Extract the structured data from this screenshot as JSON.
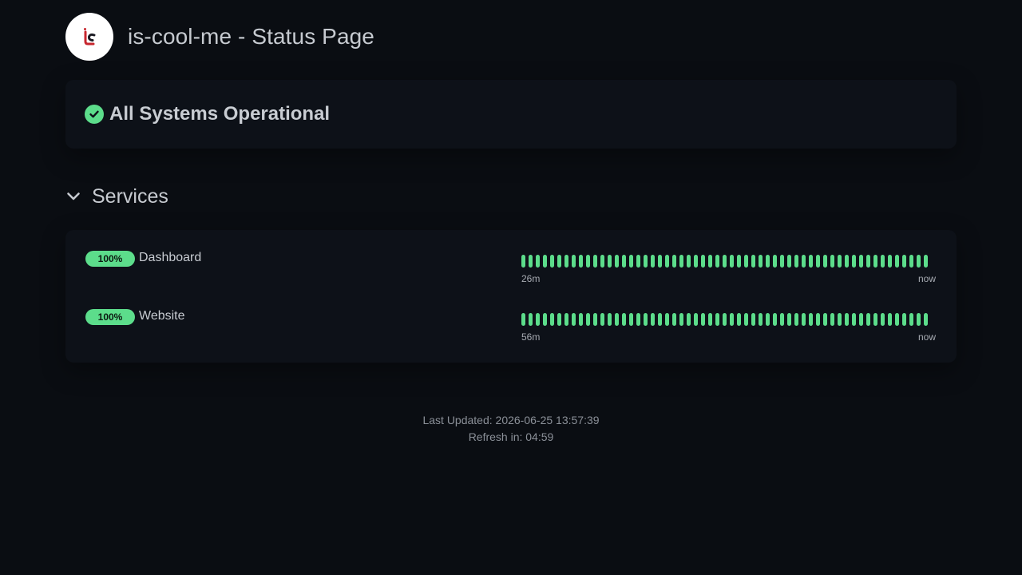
{
  "header": {
    "title": "is-cool-me - Status Page",
    "logo_icon": "brand-logo-icon"
  },
  "overall": {
    "text": "All Systems Operational",
    "icon": "check-circle-icon",
    "color": "#5cdd8b"
  },
  "group": {
    "title": "Services",
    "icon": "chevron-down-icon"
  },
  "services": [
    {
      "uptime": "100%",
      "name": "Dashboard",
      "from_label": "26m",
      "to_label": "now",
      "beats": 57,
      "status": "up"
    },
    {
      "uptime": "100%",
      "name": "Website",
      "from_label": "56m",
      "to_label": "now",
      "beats": 57,
      "status": "up"
    }
  ],
  "footer": {
    "last_updated": "Last Updated: 2026-06-25 13:57:39",
    "refresh": "Refresh in: 04:59"
  },
  "colors": {
    "background": "#0a0d12",
    "card": "#0d1118",
    "up": "#5cdd8b",
    "brand_red": "#c7262e"
  }
}
